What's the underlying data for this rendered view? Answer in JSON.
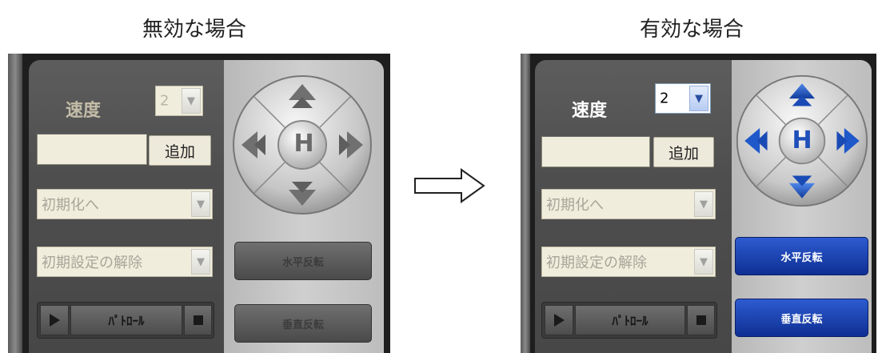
{
  "captions": {
    "disabled": "無効な場合",
    "enabled": "有効な場合"
  },
  "disabled_panel": {
    "speed_label": "速度",
    "speed_value": "2",
    "add_button": "追加",
    "preset_select": "初期化へ",
    "clear_preset_select": "初期設定の解除",
    "patrol_label": "ﾊﾟﾄﾛｰﾙ",
    "home_label": "H",
    "horizontal_button": "水平反転",
    "vertical_button": "垂直反転",
    "enabled": false
  },
  "enabled_panel": {
    "speed_label": "速度",
    "speed_value": "2",
    "add_button": "追加",
    "preset_select": "初期化へ",
    "clear_preset_select": "初期設定の解除",
    "patrol_label": "ﾊﾟﾄﾛｰﾙ",
    "home_label": "H",
    "horizontal_button": "水平反転",
    "vertical_button": "垂直反転",
    "enabled": true
  },
  "icons": {
    "arrow": "right-arrow-icon",
    "play": "play-icon",
    "stop": "stop-icon",
    "dropdown": "chevron-down-icon",
    "pan_up": "pan-up-icon",
    "pan_down": "pan-down-icon",
    "pan_left": "pan-left-icon",
    "pan_right": "pan-right-icon",
    "home": "home-icon"
  },
  "colors": {
    "enabled_accent": "#1e3fa8",
    "enabled_button": "#10309a",
    "disabled_button": "#5a5a5a",
    "panel_dark": "#4e4e4e",
    "panel_light": "#c8c8c8"
  }
}
